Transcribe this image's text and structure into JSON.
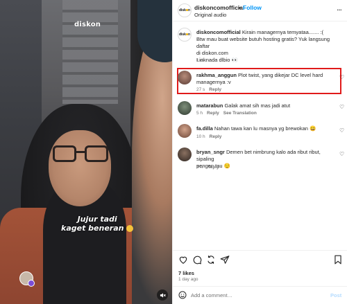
{
  "video": {
    "watermark": "diskon",
    "caption_line1": "Jujur tadi",
    "caption_line2": "kaget beneran",
    "mute_icon": "speaker-muted-icon"
  },
  "header": {
    "username": "diskoncomofficial",
    "separator": "•",
    "follow_label": "Follow",
    "audio_label": "Original audio",
    "more_label": "..."
  },
  "caption_comment": {
    "username": "diskoncomofficial",
    "text_line1": "Kirain managernya temyataa....... :(",
    "text_line2": "Btw mau buat website butuh hosting gratis? Yuk langsung daftar",
    "text_line3": "di diskon.com",
    "text_line4": "Linknada dlbio 👀",
    "time": "1 d"
  },
  "comments": [
    {
      "username": "rakhma_anggun",
      "text_line1": "Plot twist, yang dikejar DC level hard",
      "text_line2": "managernya :v",
      "time": "27 s",
      "reply": "Reply",
      "extra": ""
    },
    {
      "username": "matarabun",
      "text_line1": "Galak amat sih mas jadi atut",
      "text_line2": "",
      "time": "5 h",
      "reply": "Reply",
      "extra": "See Translation"
    },
    {
      "username": "fa.dilla",
      "text_line1": "Nahan tawa kan lu masnya yg brewokan 😄",
      "text_line2": "",
      "time": "10 h",
      "reply": "Reply",
      "extra": ""
    },
    {
      "username": "bryan_sngr",
      "text_line1": "Demen bet nimbrung kalo ada ribut ribut, sipaling",
      "text_line2": "pengen tau 😌",
      "time": "4 h",
      "reply": "Reply",
      "extra": ""
    }
  ],
  "actions": {
    "likes": "7 likes",
    "ago": "1 day ago"
  },
  "add_comment": {
    "placeholder": "Add a comment…",
    "post_label": "Post"
  },
  "colors": {
    "accent": "#0095f6",
    "highlight": "#e01a1a",
    "muted_text": "#737373"
  }
}
